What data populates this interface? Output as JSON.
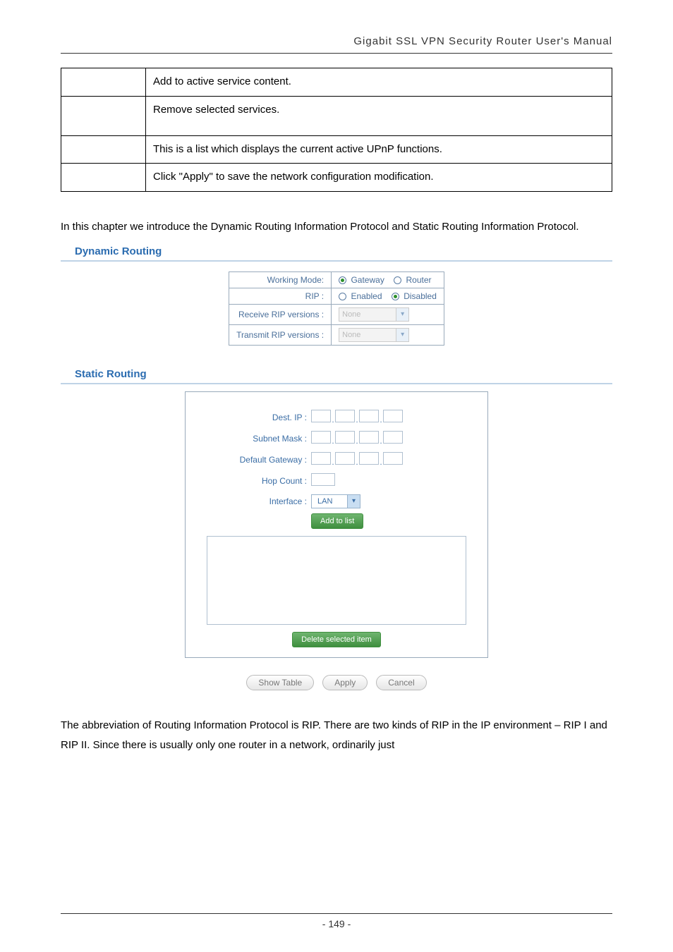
{
  "header": {
    "title": "Gigabit SSL VPN Security Router User's Manual"
  },
  "table_rows": [
    {
      "left": "",
      "right": "Add to active service content."
    },
    {
      "left": "",
      "right": "Remove selected services."
    },
    {
      "left": "",
      "right": "This is a list which displays the current active UPnP functions."
    },
    {
      "left": "",
      "right": "Click \"Apply\" to save the network configuration modification."
    }
  ],
  "intro_text": "In this chapter we introduce the Dynamic Routing Information Protocol and Static Routing Information Protocol.",
  "dynamic": {
    "heading": "Dynamic Routing",
    "working_mode_label": "Working Mode:",
    "gateway_label": "Gateway",
    "router_label": "Router",
    "rip_label": "RIP :",
    "enabled_label": "Enabled",
    "disabled_label": "Disabled",
    "recv_label": "Receive RIP versions :",
    "trans_label": "Transmit RIP versions :",
    "none_text": "None"
  },
  "static": {
    "heading": "Static Routing",
    "dest_ip": "Dest. IP :",
    "subnet_mask": "Subnet Mask :",
    "default_gateway": "Default Gateway :",
    "hop_count": "Hop Count :",
    "interface": "Interface :",
    "interface_val": "LAN",
    "add_to_list": "Add to list",
    "delete_selected": "Delete selected item"
  },
  "buttons": {
    "show_table": "Show Table",
    "apply": "Apply",
    "cancel": "Cancel"
  },
  "foot_para": "The abbreviation of Routing Information Protocol is RIP. There are two kinds of RIP in the IP environment – RIP I and RIP II. Since there is usually only one router in a network, ordinarily just",
  "page_num": "- 149 -"
}
